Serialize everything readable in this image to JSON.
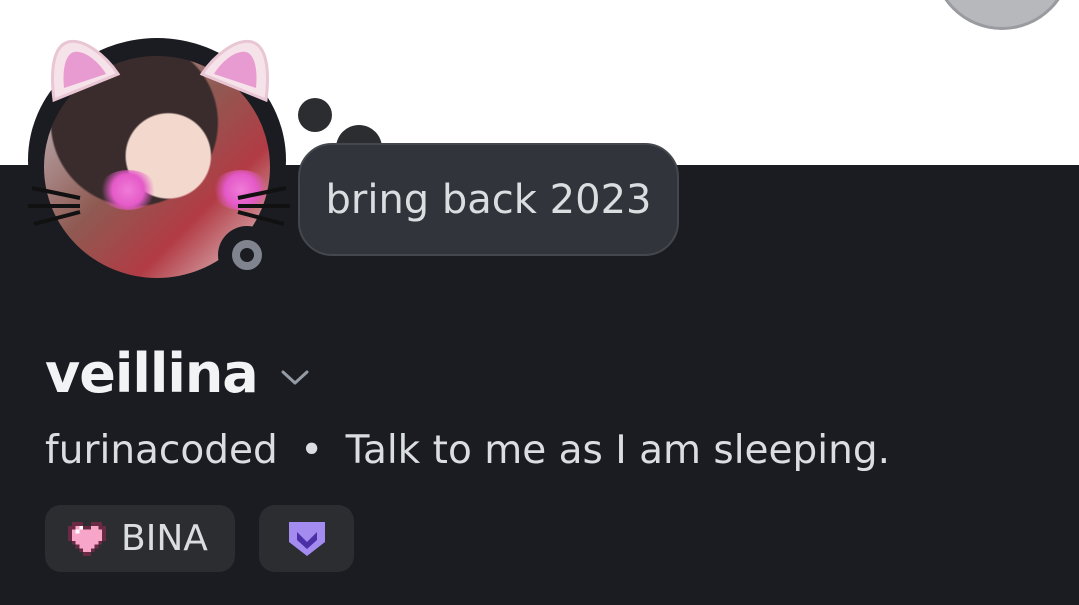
{
  "profile": {
    "display_name": "veillina",
    "subtitle_pronouns": "furinacoded",
    "subtitle_separator": "•",
    "subtitle_bio": "Talk to me as I am sleeping.",
    "custom_status": "bring back 2023",
    "status": "offline"
  },
  "badges": [
    {
      "label": "BINA",
      "icon": "pixel-heart-icon"
    },
    {
      "label": "",
      "icon": "purple-chevron-shield-icon"
    }
  ],
  "colors": {
    "background": "#1b1c21",
    "banner": "#ffffff",
    "accent_heart": "#f7a6c9",
    "accent_purple": "#a48bf0"
  }
}
